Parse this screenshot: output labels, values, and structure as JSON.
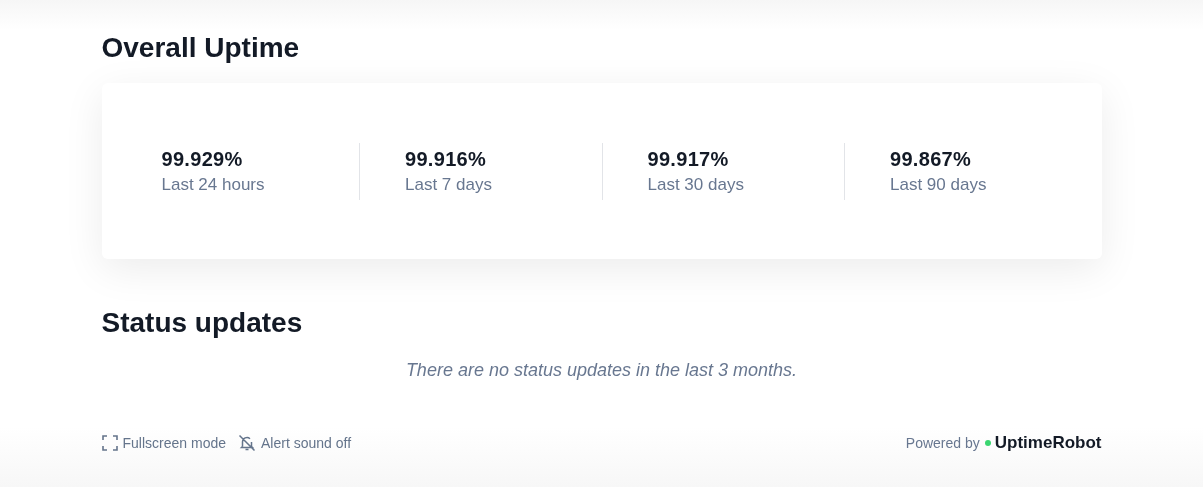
{
  "uptime": {
    "title": "Overall Uptime",
    "stats": [
      {
        "value": "99.929%",
        "label": "Last 24 hours"
      },
      {
        "value": "99.916%",
        "label": "Last 7 days"
      },
      {
        "value": "99.917%",
        "label": "Last 30 days"
      },
      {
        "value": "99.867%",
        "label": "Last 90 days"
      }
    ]
  },
  "status_updates": {
    "title": "Status updates",
    "empty_message": "There are no status updates in the last 3 months."
  },
  "footer": {
    "fullscreen": "Fullscreen mode",
    "alert_sound": "Alert sound off",
    "powered_by": "Powered by",
    "brand": "UptimeRobot"
  }
}
